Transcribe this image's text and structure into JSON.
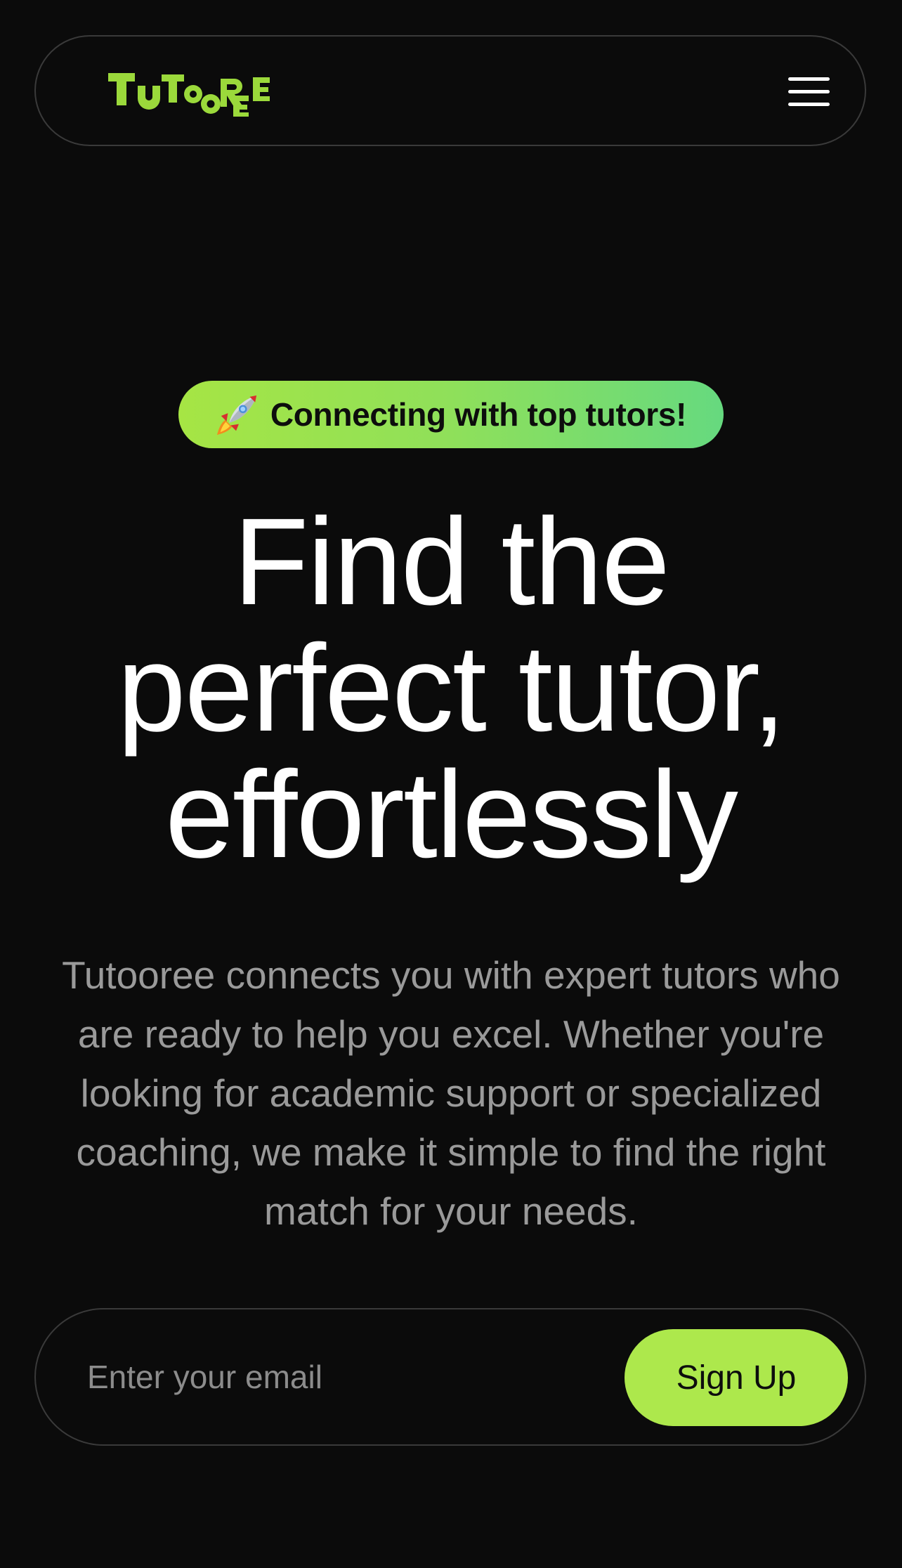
{
  "header": {
    "logo_text": "TUTOOREE",
    "logo_icon": "tutooree-wordmark",
    "menu_icon": "hamburger-menu-icon"
  },
  "badge": {
    "icon": "rocket-icon",
    "text": "Connecting with top tutors!"
  },
  "hero": {
    "title_lines": [
      "Find the",
      "perfect tutor,",
      "effortlessly"
    ],
    "description": "Tutooree connects you with expert tutors who are ready to help you excel. Whether you're looking for academic support or specialized coaching, we make it simple to find the right match for your needs."
  },
  "signup": {
    "email_placeholder": "Enter your email",
    "email_value": "",
    "button_label": "Sign Up"
  },
  "colors": {
    "background": "#0b0b0b",
    "accent": "#ade84c",
    "badge_gradient_start": "#a6e544",
    "badge_gradient_end": "#66d97f",
    "border": "#3a3a3a",
    "muted_text": "#9a9a9a"
  }
}
